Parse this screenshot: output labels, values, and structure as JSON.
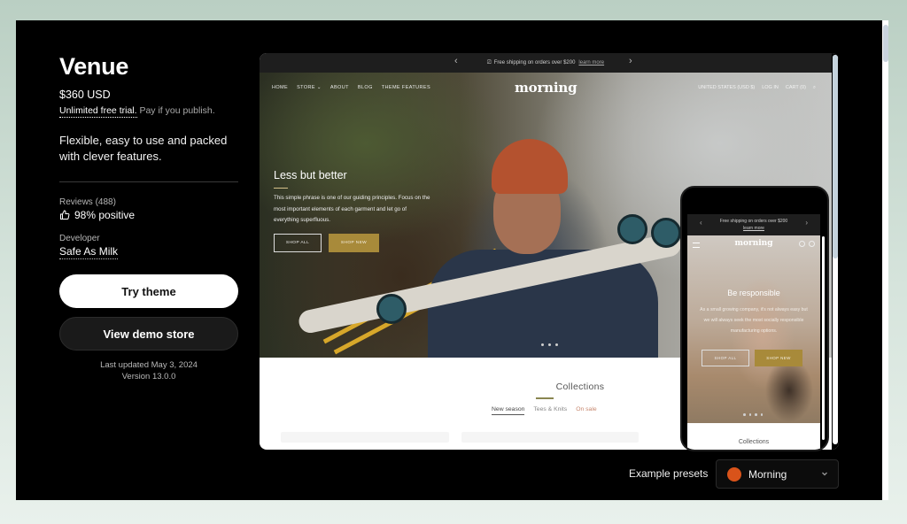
{
  "theme": {
    "name": "Venue",
    "price": "$360 USD",
    "trial_link": "Unlimited free trial.",
    "trial_note": "Pay if you publish.",
    "tagline": "Flexible, easy to use and packed with clever features.",
    "reviews_label": "Reviews (488)",
    "reviews_value": "98% positive",
    "developer_label": "Developer",
    "developer_name": "Safe As Milk",
    "try_button": "Try theme",
    "demo_button": "View demo store",
    "last_updated": "Last updated May 3, 2024",
    "version": "Version 13.0.0"
  },
  "desktop_preview": {
    "announcement": "Free shipping on orders over $200",
    "announcement_link": "learn more",
    "nav": [
      "HOME",
      "STORE ⌄",
      "ABOUT",
      "BLOG",
      "THEME FEATURES"
    ],
    "logo": "morning",
    "right_nav": [
      "UNITED STATES (USD $)",
      "LOG IN",
      "CART (0)"
    ],
    "hero_heading": "Less but better",
    "hero_text": "This simple phrase is one of our guiding principles. Focus on the most important elements of each garment and let go of everything superfluous.",
    "hero_buttons": [
      "SHOP ALL",
      "SHOP NEW"
    ],
    "collections_heading": "Collections",
    "collection_tabs": [
      "New season",
      "Tees & Knits",
      "On sale"
    ],
    "active_tab": "New season"
  },
  "mobile_preview": {
    "announcement": "Free shipping on orders over $200",
    "announcement_link": "learn more",
    "logo": "morning",
    "hero_heading": "Be responsible",
    "hero_text": "As a small growing company, it's not always easy but we will always seek the most socially responsible manufacturing options.",
    "hero_buttons": [
      "SHOP ALL",
      "SHOP NEW"
    ],
    "collections_heading": "Collections"
  },
  "presets": {
    "label": "Example presets",
    "selected": "Morning",
    "selected_color": "#d9531a"
  }
}
